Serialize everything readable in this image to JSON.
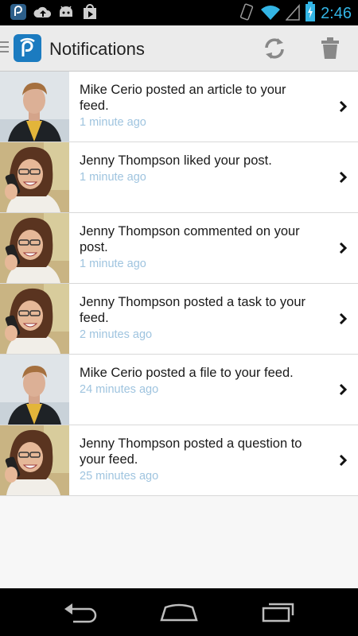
{
  "status_bar": {
    "time": "2:46",
    "left_icons": [
      "app-notification-icon",
      "cloud-upload-icon",
      "android-debug-icon",
      "play-store-icon"
    ],
    "right_icons": [
      "vibrate-icon",
      "wifi-icon",
      "signal-icon",
      "battery-charging-icon"
    ]
  },
  "action_bar": {
    "title": "Notifications",
    "logo_letter": "p",
    "actions": [
      "refresh-icon",
      "trash-icon"
    ]
  },
  "notifications": [
    {
      "message": "Mike Cerio posted an article to your feed.",
      "time": "1 minute ago",
      "avatar": "man"
    },
    {
      "message": "Jenny Thompson liked your post.",
      "time": "1 minute ago",
      "avatar": "woman"
    },
    {
      "message": "Jenny Thompson commented on your post.",
      "time": "1 minute ago",
      "avatar": "woman"
    },
    {
      "message": "Jenny Thompson posted a task to your feed.",
      "time": "2 minutes ago",
      "avatar": "woman"
    },
    {
      "message": "Mike Cerio posted a file to your feed.",
      "time": "24 minutes ago",
      "avatar": "man"
    },
    {
      "message": "Jenny Thompson posted a question to your feed.",
      "time": "25 minutes ago",
      "avatar": "woman"
    }
  ],
  "nav_bar": [
    "back-icon",
    "home-icon",
    "recent-apps-icon"
  ],
  "colors": {
    "accent": "#33b5e5",
    "time_text": "#9fc4df",
    "logo_bg": "#1b7bc0",
    "action_bar_bg": "#ebebeb"
  }
}
